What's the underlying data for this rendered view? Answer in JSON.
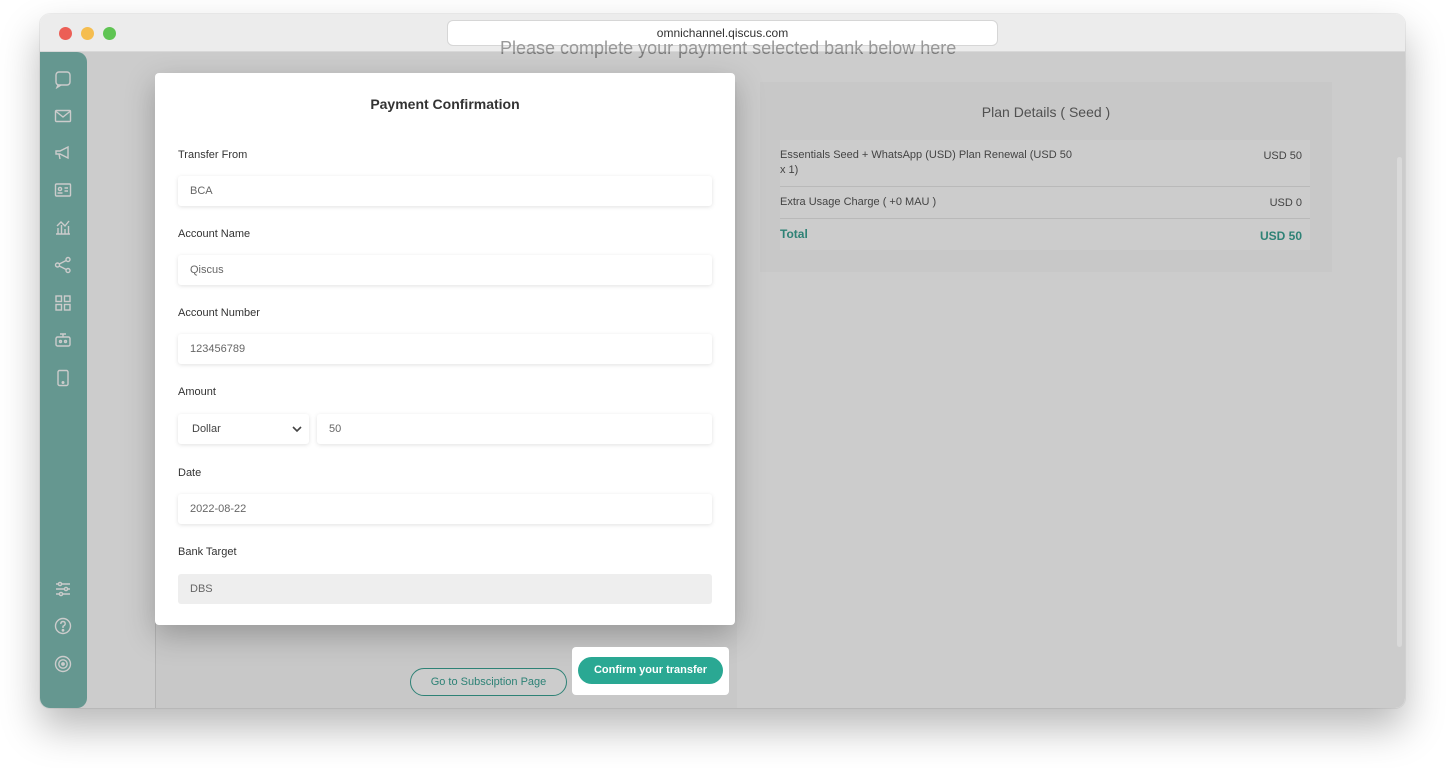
{
  "browser": {
    "url": "omnichannel.qiscus.com"
  },
  "background": {
    "page_heading": "Please complete your payment selected bank below here",
    "plan": {
      "title": "Plan Details ( Seed )",
      "rows": [
        {
          "desc": "Essentials Seed + WhatsApp (USD) Plan Renewal (USD 50 x 1)",
          "amount": "USD 50"
        },
        {
          "desc": "Extra Usage Charge ( +0 MAU )",
          "amount": "USD 0"
        }
      ],
      "total_label": "Total",
      "total_amount": "USD 50"
    },
    "subscription_button": "Go to Subsciption Page"
  },
  "modal": {
    "title": "Payment Confirmation",
    "transfer_from": {
      "label": "Transfer From",
      "value": "BCA"
    },
    "account_name": {
      "label": "Account Name",
      "value": "Qiscus"
    },
    "account_number": {
      "label": "Account Number",
      "value": "123456789"
    },
    "amount": {
      "label": "Amount",
      "currency": "Dollar",
      "value": "50"
    },
    "date": {
      "label": "Date",
      "value": "2022-08-22"
    },
    "bank_target": {
      "label": "Bank Target",
      "value": "DBS"
    }
  },
  "confirm_button": "Confirm your transfer",
  "colors": {
    "accent": "#2aa893",
    "sidebar": "#7fbdb4"
  },
  "sidebar_icons": [
    "chat-icon",
    "mail-icon",
    "megaphone-icon",
    "contact-card-icon",
    "analytics-icon",
    "share-nodes-icon",
    "apps-grid-icon",
    "robot-icon",
    "mobile-icon",
    "settings-sliders-icon",
    "help-icon",
    "target-icon"
  ]
}
